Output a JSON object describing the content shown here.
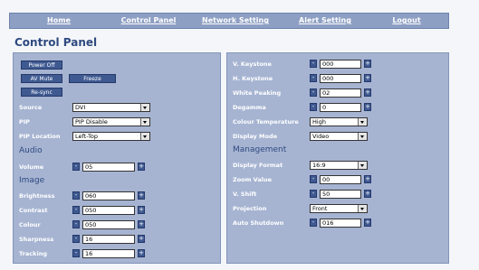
{
  "nav": {
    "home": "Home",
    "control_panel": "Control Panel",
    "network_setting": "Network Setting",
    "alert_setting": "Alert Setting",
    "logout": "Logout"
  },
  "title": "Control Panel",
  "buttons": {
    "power_off": "Power Off",
    "av_mute": "AV Mute",
    "freeze": "Freeze",
    "resync": "Re-sync"
  },
  "labels": {
    "source": "Source",
    "pip": "PIP",
    "pip_location": "PIP Location",
    "audio": "Audio",
    "volume": "Volume",
    "image": "Image",
    "brightness": "Brightness",
    "contrast": "Contrast",
    "colour": "Colour",
    "sharpness": "Sharpness",
    "tracking": "Tracking",
    "v_keystone": "V. Keystone",
    "h_keystone": "H. Keystone",
    "white_peaking": "White Peaking",
    "degamma": "Degamma",
    "colour_temperature": "Colour Temperature",
    "display_mode": "Display Mode",
    "management": "Management",
    "display_format": "Display Format",
    "zoom_value": "Zoom Value",
    "v_shift": "V. Shift",
    "projection": "Projection",
    "auto_shutdown": "Auto Shutdown"
  },
  "values": {
    "source": "DVI",
    "pip": "PIP Disable",
    "pip_location": "Left-Top",
    "volume": "05",
    "brightness": "060",
    "contrast": "050",
    "colour": "050",
    "sharpness": "16",
    "tracking": "16",
    "v_keystone": "000",
    "h_keystone": "000",
    "white_peaking": "02",
    "degamma": "0",
    "colour_temperature": "High",
    "display_mode": "Video",
    "display_format": "16:9",
    "zoom_value": "00",
    "v_shift": "50",
    "projection": "Front",
    "auto_shutdown": "016"
  },
  "colors": {
    "nav_bg": "#8d9fc3",
    "panel_bg": "#a6b4d2",
    "button_bg": "#3f5a91",
    "title": "#2f4a80"
  }
}
